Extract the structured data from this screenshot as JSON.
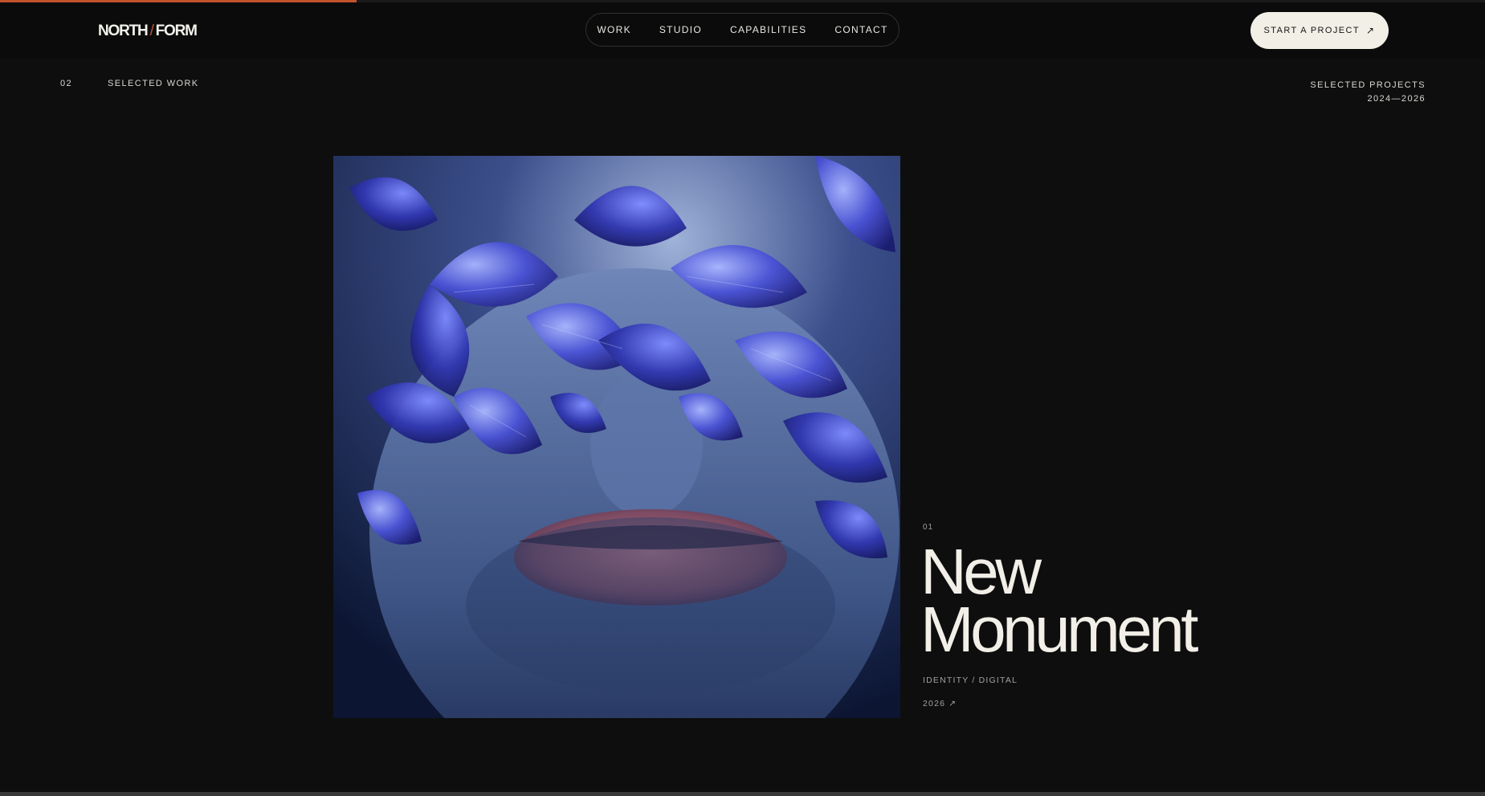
{
  "progress": {
    "fraction": 0.24,
    "color": "#c2532d"
  },
  "header": {
    "logo": {
      "left": "NORTH",
      "slash": "/",
      "right": "FORM"
    },
    "nav": [
      "WORK",
      "STUDIO",
      "CAPABILITIES",
      "CONTACT"
    ],
    "cta": {
      "label": "START A PROJECT",
      "arrow": "↗"
    }
  },
  "section": {
    "number": "02",
    "label": "SELECTED WORK",
    "meta_line1": "SELECTED PROJECTS",
    "meta_line2": "2024—2026"
  },
  "project": {
    "index": "01",
    "title_line1": "New",
    "title_line2": "Monument",
    "tags": "IDENTITY / DIGITAL",
    "year": "2026 ↗"
  },
  "colors": {
    "background": "#0e0e0e",
    "accent": "#c2532d",
    "text": "#f1efe7",
    "cta_bg": "#f1efe6"
  }
}
